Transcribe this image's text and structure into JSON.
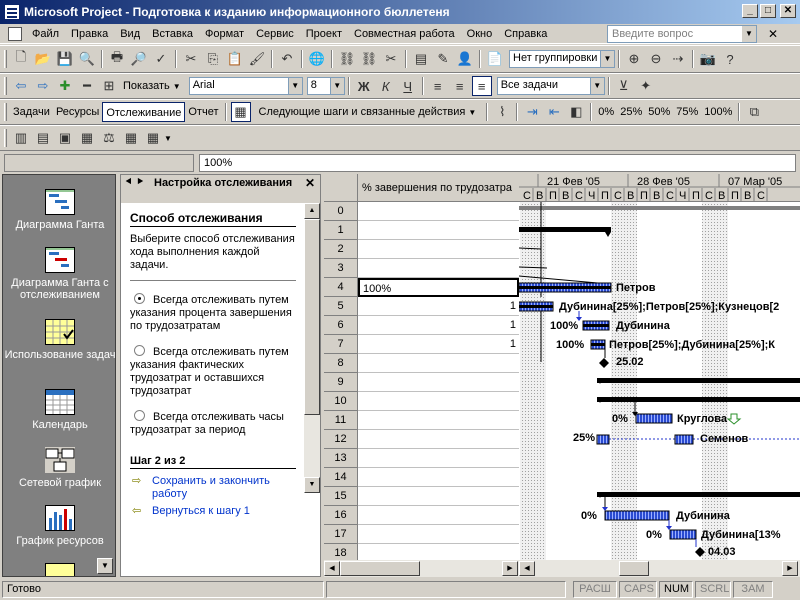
{
  "window": {
    "title": "Microsoft Project - Подготовка к изданию информационного бюллетеня",
    "btn_min": "_",
    "btn_max": "□",
    "btn_close": "✕"
  },
  "menu": {
    "items": [
      "Файл",
      "Правка",
      "Вид",
      "Вставка",
      "Формат",
      "Сервис",
      "Проект",
      "Совместная работа",
      "Окно",
      "Справка"
    ],
    "help_placeholder": "Введите вопрос",
    "close_doc": "✕"
  },
  "toolbar1": {
    "grouping": "Нет группировки"
  },
  "toolbar2": {
    "show_label": "Показать",
    "font": "Arial",
    "size": "8",
    "bold": "Ж",
    "italic": "К",
    "underline": "Ч",
    "filter": "Все задачи"
  },
  "toolbar3": {
    "tabs": [
      "Задачи",
      "Ресурсы",
      "Отслеживание",
      "Отчет"
    ],
    "active_tab": "Отслеживание",
    "next_steps": "Следующие шаги и связанные действия",
    "percent_labels": [
      "0%",
      "25%",
      "50%",
      "75%",
      "100%"
    ]
  },
  "entry_bar": {
    "value": "100%"
  },
  "view_bar": {
    "items": [
      "Диаграмма Ганта",
      "Диаграмма Ганта с отслеживанием",
      "Использование задач",
      "Календарь",
      "Сетевой график",
      "График ресурсов"
    ]
  },
  "side_pane": {
    "title": "Настройка отслеживания",
    "heading": "Способ отслеживания",
    "intro": "Выберите способ отслеживания хода выполнения каждой задачи.",
    "options": [
      "Всегда отслеживать путем указания процента завершения по трудозатратам",
      "Всегда отслеживать путем указания фактических трудозатрат и оставшихся трудозатрат",
      "Всегда отслеживать часы трудозатрат за период"
    ],
    "selected_option": 0,
    "step": "Шаг 2 из 2",
    "link_save": "Сохранить и закончить работу",
    "link_back": "Вернуться к шагу 1"
  },
  "table": {
    "column": "% завершения по трудозатра",
    "rows": [
      {
        "id": "0",
        "value": ""
      },
      {
        "id": "1",
        "value": ""
      },
      {
        "id": "2",
        "value": ""
      },
      {
        "id": "3",
        "value": ""
      },
      {
        "id": "4",
        "value": "100%"
      },
      {
        "id": "5",
        "value": "1"
      },
      {
        "id": "6",
        "value": "1"
      },
      {
        "id": "7",
        "value": "1"
      },
      {
        "id": "8",
        "value": ""
      },
      {
        "id": "9",
        "value": ""
      },
      {
        "id": "10",
        "value": ""
      },
      {
        "id": "11",
        "value": ""
      },
      {
        "id": "12",
        "value": ""
      },
      {
        "id": "13",
        "value": ""
      },
      {
        "id": "14",
        "value": ""
      },
      {
        "id": "15",
        "value": ""
      },
      {
        "id": "16",
        "value": ""
      },
      {
        "id": "17",
        "value": ""
      },
      {
        "id": "18",
        "value": ""
      }
    ]
  },
  "gantt": {
    "weeks": [
      "21 Фев '05",
      "28 Фев '05",
      "07 Мар '05"
    ],
    "days": [
      "С",
      "В",
      "П",
      "В",
      "С",
      "Ч",
      "П",
      "С",
      "В",
      "П",
      "В",
      "С",
      "Ч",
      "П",
      "С",
      "В",
      "П",
      "В",
      "С"
    ],
    "labels": {
      "r4": "Петров",
      "r5": "Дубинина[25%];Петров[25%];Кузнецов[2",
      "r6_pct": "100%",
      "r6": "Дубинина",
      "r7_pct": "100%",
      "r7": "Петров[25%];Дубинина[25%];К",
      "r8": "25.02",
      "r11_pct": "0%",
      "r11": "Круглова",
      "r12_pct": "25%",
      "r12": "Семенов",
      "r16_pct": "0%",
      "r16": "Дубинина",
      "r17_pct": "0%",
      "r17": "Дубинина[13%",
      "r18": "04.03"
    }
  },
  "status_bar": {
    "ready": "Готово",
    "indicators": [
      "РАСШ",
      "CAPS",
      "NUM",
      "SCRL",
      "ЗАМ"
    ],
    "active_indicator": "NUM"
  }
}
